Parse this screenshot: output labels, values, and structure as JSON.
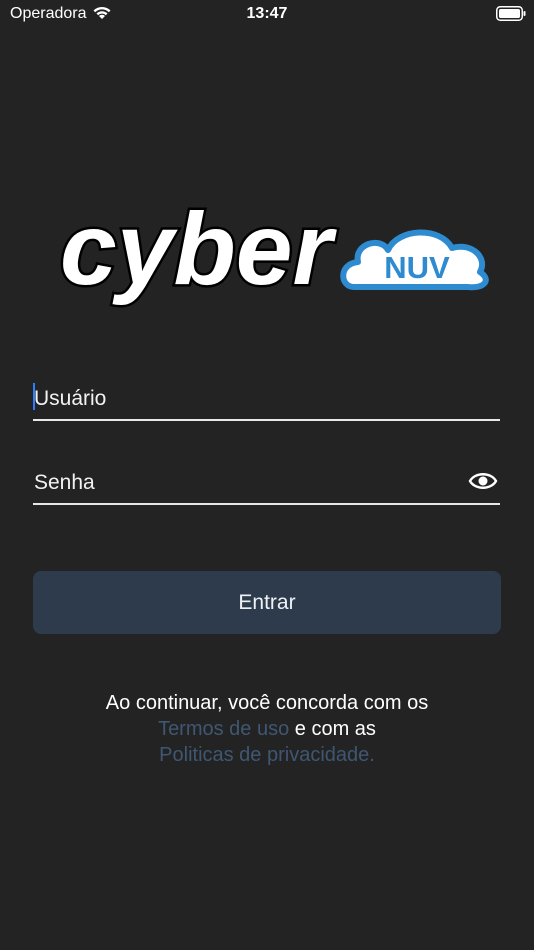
{
  "status_bar": {
    "carrier": "Operadora",
    "time": "13:47",
    "wifi_icon": "wifi-icon",
    "battery_icon": "battery-icon"
  },
  "logo": {
    "text_main": "cyber",
    "text_badge": "NUV",
    "badge_color": "#2e8bd0"
  },
  "form": {
    "username_placeholder": "Usuário",
    "password_placeholder": "Senha",
    "password_toggle_icon": "eye-icon",
    "submit_label": "Entrar",
    "cursor_color": "#2f7dff"
  },
  "terms": {
    "line1": "Ao continuar, você concorda com os",
    "terms_link": "Termos de uso",
    "connector": " e com as",
    "privacy_link": "Politicas de privacidade.",
    "link_color": "#3f5772"
  },
  "colors": {
    "background": "#232323",
    "button": "#2d3b4c"
  }
}
